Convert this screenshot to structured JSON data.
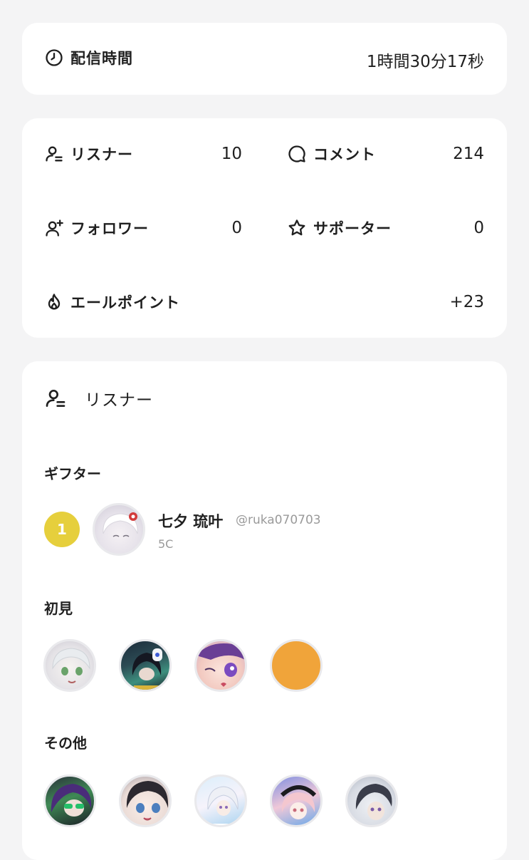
{
  "duration": {
    "label": "配信時間",
    "value": "1時間30分17秒",
    "icon": "clock-icon"
  },
  "stats": {
    "listeners": {
      "label": "リスナー",
      "value": "10",
      "icon": "listener-icon"
    },
    "comments": {
      "label": "コメント",
      "value": "214",
      "icon": "comment-icon"
    },
    "followers": {
      "label": "フォロワー",
      "value": "0",
      "icon": "add-user-icon"
    },
    "supporters": {
      "label": "サポーター",
      "value": "0",
      "icon": "star-icon"
    },
    "yell_points": {
      "label": "エールポイント",
      "value": "+23",
      "icon": "flame-icon"
    }
  },
  "listener_panel": {
    "title": "リスナー",
    "icon": "listener-icon",
    "gifters": {
      "heading": "ギフター",
      "items": [
        {
          "rank": "1",
          "name": "七夕 琉叶",
          "handle": "@ruka070703",
          "amount": "5C"
        }
      ]
    },
    "first_time": {
      "heading": "初見"
    },
    "others": {
      "heading": "その他"
    }
  },
  "colors": {
    "rank_gold": "#e6cf3c",
    "orange_avatar": "#f0a43a",
    "background": "#f4f4f5",
    "card": "#ffffff"
  }
}
